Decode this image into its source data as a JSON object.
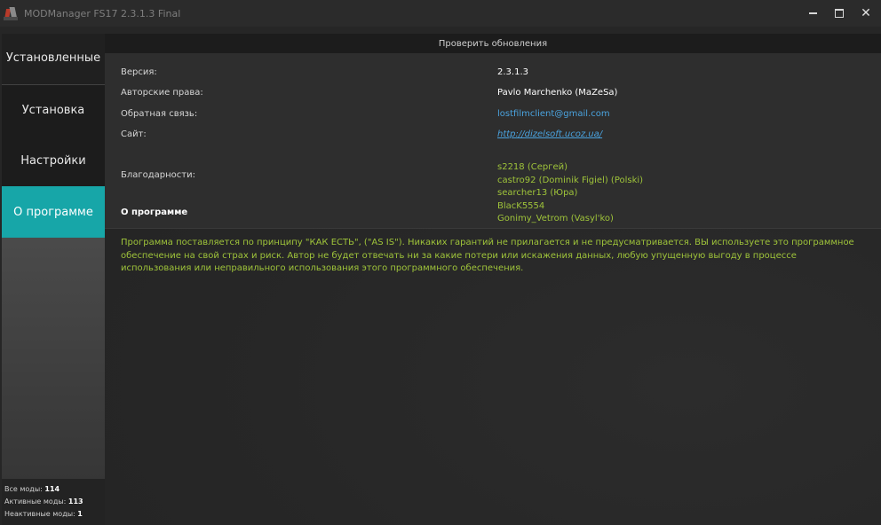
{
  "window": {
    "title": "MODManager FS17 2.3.1.3 Final",
    "close_glyph": "✕"
  },
  "sidebar": {
    "items": [
      {
        "label": "Установленные"
      },
      {
        "label": "Установка"
      },
      {
        "label": "Настройки"
      },
      {
        "label": "О программе",
        "active": true
      }
    ],
    "stats": [
      {
        "label": "Все моды:",
        "value": "114"
      },
      {
        "label": "Активные моды:",
        "value": "113"
      },
      {
        "label": "Неактивные моды:",
        "value": "1"
      }
    ]
  },
  "header": {
    "check_updates_label": "Проверить обновления"
  },
  "about": {
    "rows": [
      {
        "label": "Версия:",
        "value": "2.3.1.3"
      },
      {
        "label": "Авторские права:",
        "value": "Pavlo Marchenko (MaZeSa)"
      },
      {
        "label": "Обратная связь:",
        "value": "lostfilmclient@gmail.com"
      },
      {
        "label": "Сайт:",
        "value": "http://dizelsoft.ucoz.ua/"
      }
    ],
    "thanks_label": "Благодарности:",
    "thanks": [
      "s2218 (Сергей)",
      "castro92 (Dominik Figiel) (Polski)",
      "searcher13 (Юра)",
      "BlacK5554",
      "Gonimy_Vetrom (Vasyl'ko)"
    ],
    "section_title": "О программе",
    "disclaimer": "Программа поставляется по принципу \"КАК ЕСТЬ\", (\"AS IS\"). Никаких гарантий не прилагается и не предусматривается. ВЫ используете это программное обеспечение на свой страх и риск. Автор не будет отвечать ни за какие потери или искажения данных, любую упущенную выгоду в процессе использования или неправильного использования этого программного обеспечения."
  },
  "colors": {
    "accent": "#17a6a8",
    "link": "#4aa3df",
    "highlight_text": "#9fc43a"
  }
}
